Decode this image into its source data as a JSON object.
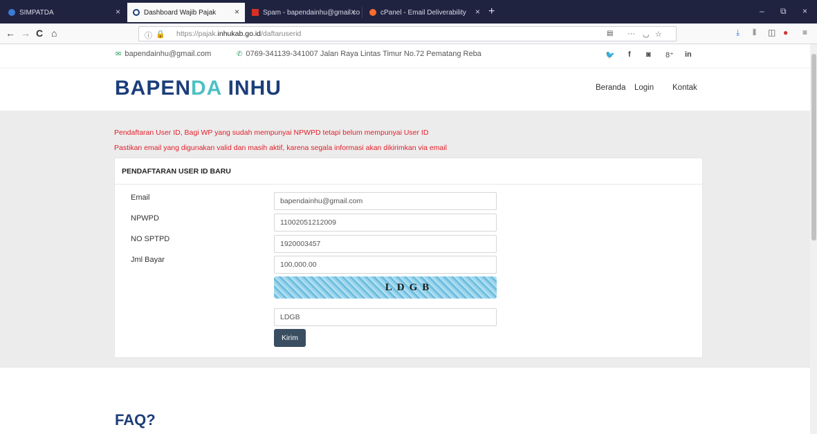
{
  "browser": {
    "tabs": [
      {
        "label": "SIMPATDA",
        "close": "×"
      },
      {
        "label": "Dashboard Wajib Pajak",
        "close": "×"
      },
      {
        "label": "Spam - bapendainhu@gmail.co",
        "close": "×"
      },
      {
        "label": "cPanel - Email Deliverability",
        "close": "×"
      }
    ],
    "new_tab": "+",
    "window_controls": [
      "–",
      "⧉",
      "×"
    ],
    "nav": {
      "back": "←",
      "forward": "→",
      "reload": "C",
      "home": "⌂"
    },
    "url_prefix": "https://pajak.",
    "url_domain": "inhukab.go.id",
    "url_path": "/daftaruserid",
    "url_actions": [
      "···",
      "☆"
    ],
    "toolbar_icons": [
      "download-icon",
      "library-icon",
      "sidebar-icon",
      "addon-icon",
      "menu-icon"
    ],
    "accent_colors": {
      "tab_bg": "#202340",
      "tab_active": "#f9f9fa"
    }
  },
  "page": {
    "topbar": {
      "email": "bapendainhu@gmail.com",
      "phone_address": "0769-341139-341007 Jalan Raya Lintas Timur No.72 Pematang Reba",
      "social": [
        "twitter-icon",
        "facebook-icon",
        "instagram-icon",
        "google-plus-icon",
        "linkedin-icon"
      ],
      "social_glyphs": [
        "𝕐",
        "f",
        "◙",
        "8⁺",
        "in"
      ]
    },
    "header": {
      "logo_part1": "BAPEN",
      "logo_part2": "DA",
      "logo_part3": " INHU",
      "menu": [
        "Beranda",
        "Login",
        "Kontak"
      ]
    },
    "notices": [
      "Pendaftaran User ID, Bagi WP yang sudah mempunyai NPWPD tetapi belum mempunyai User ID",
      "Pastikan email yang digunakan valid dan masih aktif, karena segala informasi akan dikirimkan via email"
    ],
    "form": {
      "title": "PENDAFTARAN USER ID BARU",
      "fields": [
        {
          "label": "Email",
          "value": "bapendainhu@gmail.com"
        },
        {
          "label": "NPWPD",
          "value": "11002051212009"
        },
        {
          "label": "NO SPTPD",
          "value": "1920003457"
        },
        {
          "label": "Jml Bayar",
          "value": "100,000.00"
        }
      ],
      "captcha_text": "LDGB",
      "captcha_input": "LDGB",
      "submit_label": "Kirim"
    },
    "faq_heading": "FAQ?",
    "colors": {
      "brand": "#1c3e7a",
      "accent": "#4dc0c4",
      "notice": "#e0202a",
      "button": "#3a4e62"
    }
  }
}
